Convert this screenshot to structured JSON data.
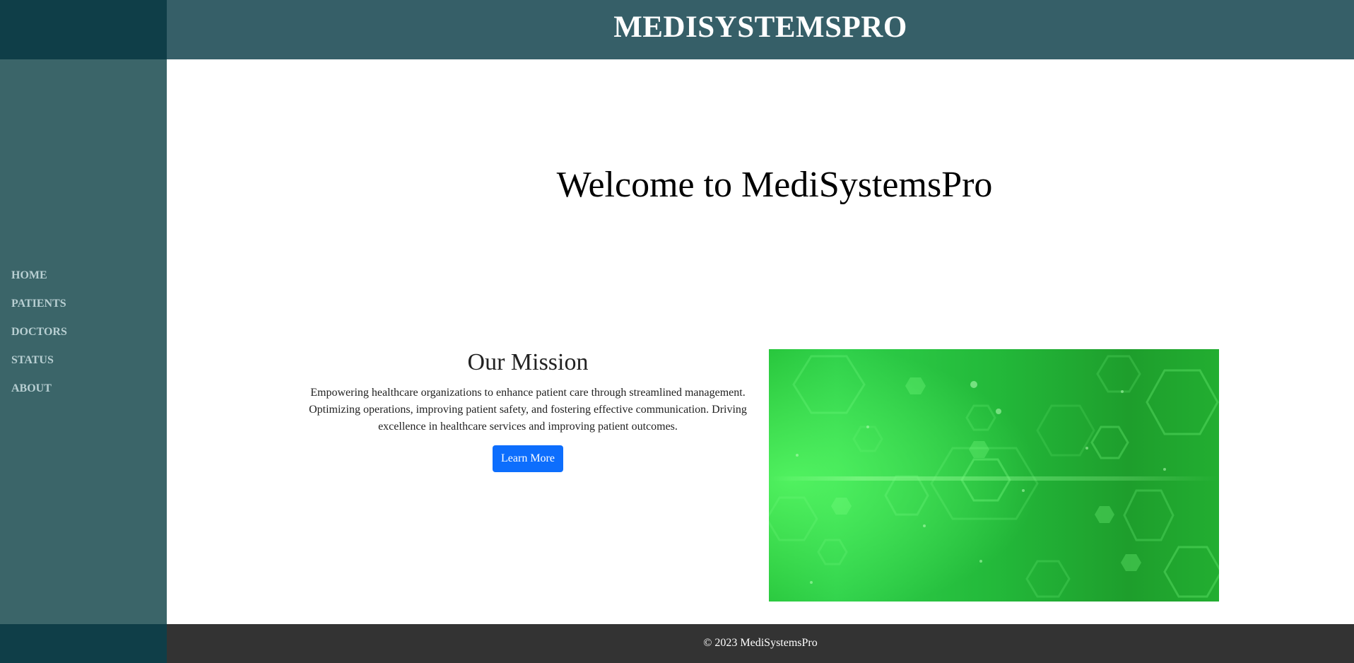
{
  "header": {
    "title": "MEDISYSTEMSPRO"
  },
  "sidebar": {
    "items": [
      {
        "label": "HOME"
      },
      {
        "label": "PATIENTS"
      },
      {
        "label": "DOCTORS"
      },
      {
        "label": "STATUS"
      },
      {
        "label": "ABOUT"
      }
    ]
  },
  "hero": {
    "title": "Welcome to MediSystemsPro"
  },
  "mission": {
    "heading": "Our Mission",
    "text": "Empowering healthcare organizations to enhance patient care through streamlined management. Optimizing operations, improving patient safety, and fostering effective communication. Driving excellence in healthcare services and improving patient outcomes.",
    "button_label": "Learn More",
    "image_icon": "green-hexagon-pattern-image"
  },
  "footer": {
    "text": "© 2023 MediSystemsPro"
  },
  "colors": {
    "brand_dark": "#0f3e48",
    "header_bg": "#365f68",
    "sidebar_bg": "#3b6569",
    "nav_text": "#b8cfd2",
    "button_bg": "#0d6efd",
    "footer_bg": "#333333",
    "image_green": "#26c43b"
  }
}
